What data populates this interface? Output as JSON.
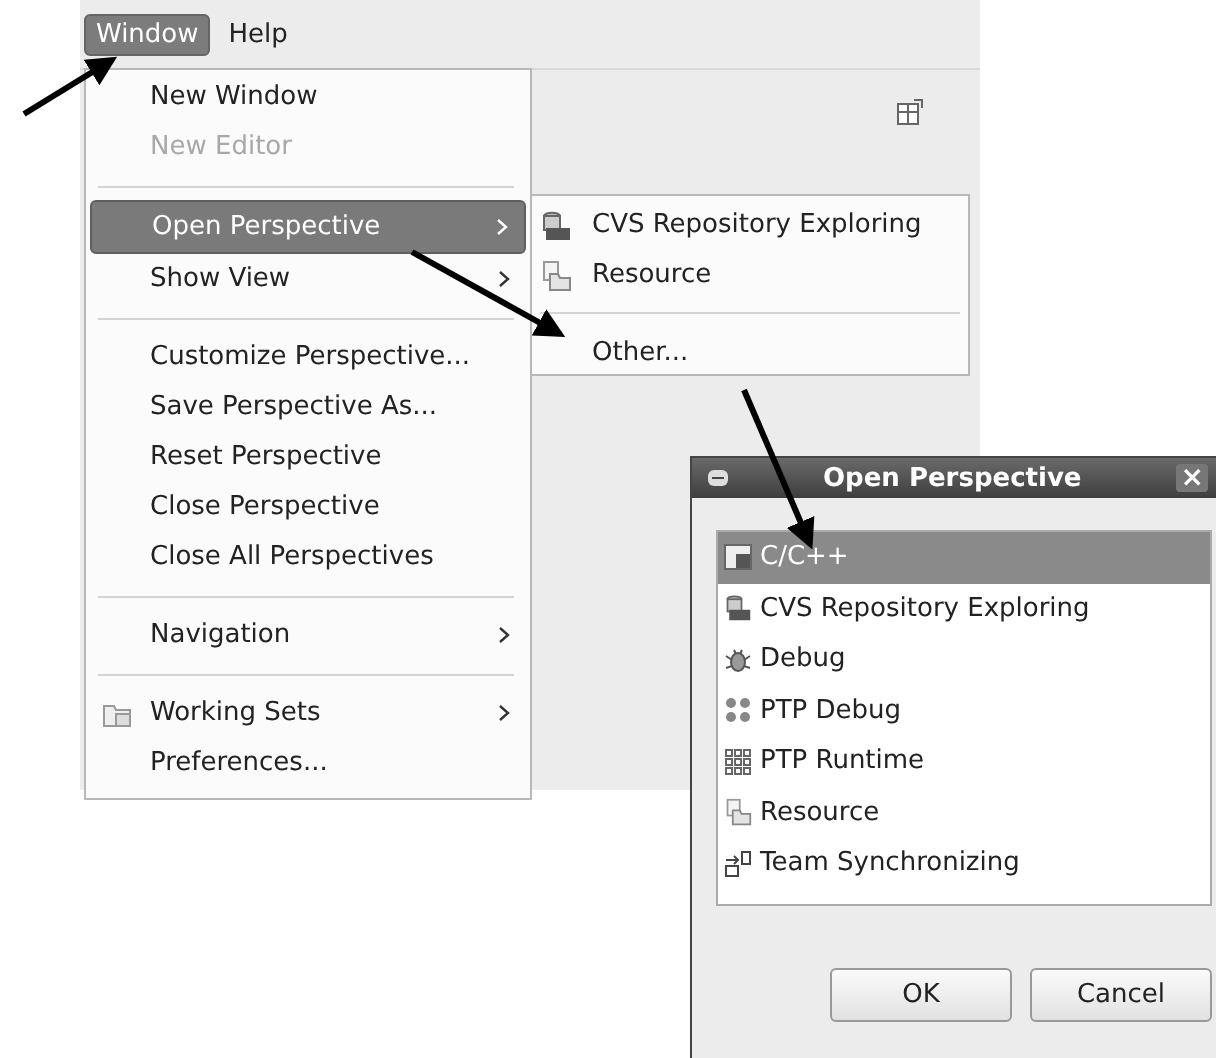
{
  "menubar": [
    {
      "label": "Window",
      "selected": true
    },
    {
      "label": "Help",
      "selected": false
    }
  ],
  "window_menu": [
    {
      "kind": "item",
      "label": "New Window",
      "disabled": false,
      "selected": false,
      "submenu": false
    },
    {
      "kind": "item",
      "label": "New Editor",
      "disabled": true,
      "selected": false,
      "submenu": false
    },
    {
      "kind": "separator"
    },
    {
      "kind": "item",
      "label": "Open Perspective",
      "disabled": false,
      "selected": true,
      "submenu": true
    },
    {
      "kind": "item",
      "label": "Show View",
      "disabled": false,
      "selected": false,
      "submenu": true
    },
    {
      "kind": "separator"
    },
    {
      "kind": "item",
      "label": "Customize Perspective...",
      "disabled": false,
      "selected": false,
      "submenu": false
    },
    {
      "kind": "item",
      "label": "Save Perspective As...",
      "disabled": false,
      "selected": false,
      "submenu": false
    },
    {
      "kind": "item",
      "label": "Reset Perspective",
      "disabled": false,
      "selected": false,
      "submenu": false
    },
    {
      "kind": "item",
      "label": "Close Perspective",
      "disabled": false,
      "selected": false,
      "submenu": false
    },
    {
      "kind": "item",
      "label": "Close All Perspectives",
      "disabled": false,
      "selected": false,
      "submenu": false
    },
    {
      "kind": "separator"
    },
    {
      "kind": "item",
      "label": "Navigation",
      "disabled": false,
      "selected": false,
      "submenu": true
    },
    {
      "kind": "separator"
    },
    {
      "kind": "icon-item",
      "label": "Working Sets",
      "disabled": false,
      "selected": false,
      "submenu": true
    },
    {
      "kind": "item",
      "label": "Preferences...",
      "disabled": false,
      "selected": false,
      "submenu": false
    }
  ],
  "perspective_submenu": [
    {
      "kind": "icon-item",
      "label": "CVS Repository Exploring"
    },
    {
      "kind": "icon-item",
      "label": "Resource"
    },
    {
      "kind": "separator"
    },
    {
      "kind": "item",
      "label": "Other..."
    }
  ],
  "dialog": {
    "title": "Open Perspective",
    "close": "×",
    "perspectives": [
      {
        "label": "C/C++",
        "selected": true
      },
      {
        "label": "CVS Repository Exploring",
        "selected": false
      },
      {
        "label": "Debug",
        "selected": false
      },
      {
        "label": "PTP Debug",
        "selected": false
      },
      {
        "label": "PTP Runtime",
        "selected": false
      },
      {
        "label": "Resource",
        "selected": false
      },
      {
        "label": "Team Synchronizing",
        "selected": false
      }
    ],
    "buttons": [
      "OK",
      "Cancel"
    ]
  }
}
